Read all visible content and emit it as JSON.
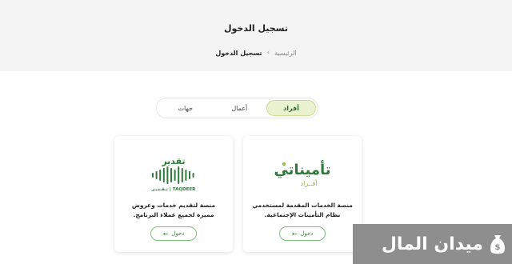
{
  "header": {
    "title": "تسجيل الدخول",
    "breadcrumb": {
      "home": "الرئيسية",
      "separator": "›",
      "current": "تسجيل الدخول"
    }
  },
  "tabs": [
    {
      "label": "أفراد",
      "active": true
    },
    {
      "label": "أعمال",
      "active": false
    },
    {
      "label": "جهات",
      "active": false
    }
  ],
  "cards": [
    {
      "logo_text": "تأميناتي",
      "logo_subtext": "أفــراد",
      "description": "منصة الخدمات المقدمة لمستخدمي نظام التأمينات الإجتماعية.",
      "button_label": "دخول",
      "button_icon": "arrow-left-icon"
    },
    {
      "logo_text": "تقدير",
      "logo_subtext": "TAQDEER | تـقـديـر",
      "description": "منصة لتقديم خدمات وعروض مميزة لجميع عملاء البرنامج.",
      "button_label": "دخول",
      "button_icon": "arrow-left-icon"
    }
  ],
  "watermark": {
    "text": "ميدان المال",
    "icon": "money-bag-icon"
  },
  "colors": {
    "accent": "#3b8a3a",
    "tab_active_bg": "#eaf3cf",
    "header_bg": "#f4f4f4"
  }
}
